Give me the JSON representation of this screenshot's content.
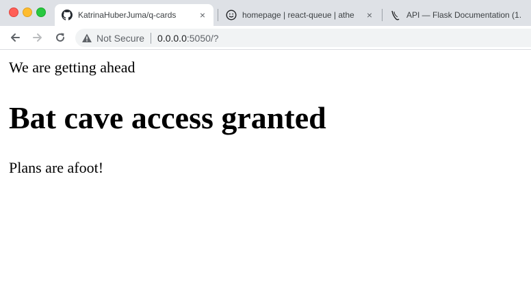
{
  "browser": {
    "tabs": [
      {
        "title": "KatrinaHuberJuma/q-cards",
        "icon": "github-icon",
        "active": true
      },
      {
        "title": "homepage | react-queue | athe",
        "icon": "smiley-icon",
        "active": false
      },
      {
        "title": "API — Flask Documentation (1.",
        "icon": "flask-icon",
        "active": false
      }
    ],
    "close_glyph": "×",
    "security_label": "Not Secure",
    "url_host": "0.0.0.0",
    "url_rest": ":5050/?"
  },
  "page": {
    "intro": "We are getting ahead",
    "heading": "Bat cave access granted",
    "plans": "Plans are afoot!"
  },
  "colors": {
    "tabstrip": "#dee1e6",
    "omnibox": "#f1f3f4",
    "close_dot": "#ff5f57",
    "minimize_dot": "#febc2e",
    "maximize_dot": "#28c840"
  }
}
